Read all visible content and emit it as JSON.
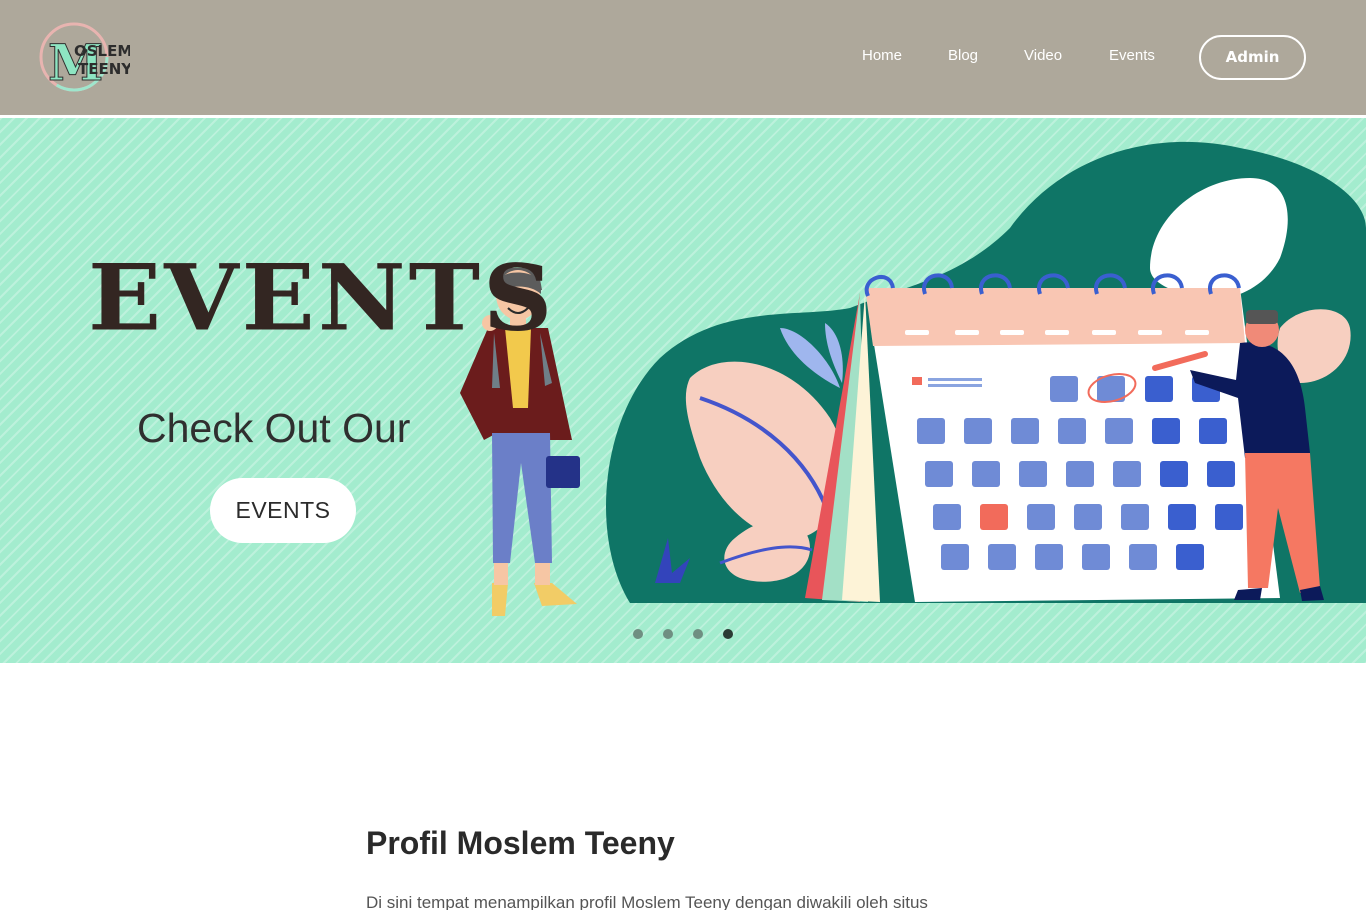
{
  "brand": {
    "logo_text_line1": "OSLEM",
    "logo_text_line2": "TEENY",
    "logo_initial": "M"
  },
  "nav": {
    "items": [
      {
        "label": "Home"
      },
      {
        "label": "Blog"
      },
      {
        "label": "Video"
      },
      {
        "label": "Events"
      }
    ],
    "admin_label": "Admin"
  },
  "hero": {
    "title": "EVENTS",
    "subtitle": "Check Out Our",
    "cta_label": "EVENTS",
    "slides": {
      "count": 4,
      "active": 4
    }
  },
  "profile": {
    "title": "Profil Moslem Teeny",
    "text": "Di sini tempat menampilkan profil Moslem Teeny dengan diwakili oleh situs"
  },
  "colors": {
    "header_bg": "#aea89b",
    "hero_bg": "#a3ecce",
    "accent_dark_green": "#0f7566",
    "calendar_blue": "#5577cc",
    "peach": "#f6c8b8"
  }
}
